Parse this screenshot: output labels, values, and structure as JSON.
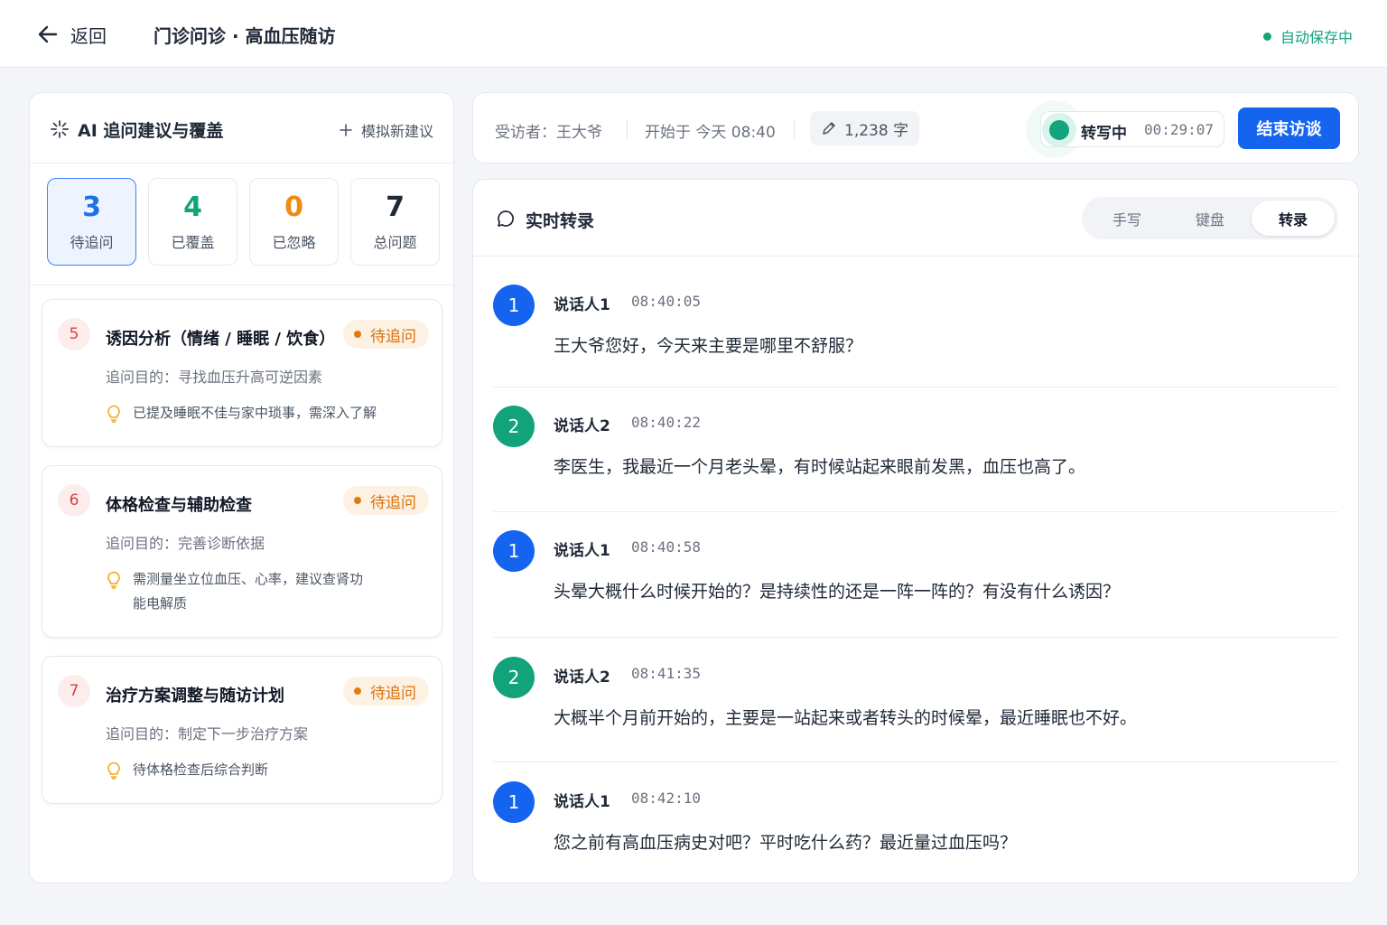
{
  "header": {
    "back_label": "返回",
    "title": "门诊问诊 · 高血压随访",
    "autosave": "自动保存中"
  },
  "left_panel": {
    "title": "AI 追问建议与覆盖",
    "simulate_label": "模拟新建议",
    "stats": [
      {
        "value": "3",
        "label": "待追问",
        "color": "#1f6fe5"
      },
      {
        "value": "4",
        "label": "已覆盖",
        "color": "#13a37a"
      },
      {
        "value": "0",
        "label": "已忽略",
        "color": "#f08a12"
      },
      {
        "value": "7",
        "label": "总问题",
        "color": "#1f2937"
      }
    ],
    "cards": [
      {
        "index": "5",
        "title": "诱因分析（情绪 / 睡眠 / 饮食）",
        "status": "待追问",
        "purpose": "追问目的：寻找血压升高可逆因素",
        "note": "已提及睡眠不佳与家中琐事，需深入了解"
      },
      {
        "index": "6",
        "title": "体格检查与辅助检查",
        "status": "待追问",
        "purpose": "追问目的：完善诊断依据",
        "note": "需测量坐立位血压、心率，建议查肾功能电解质"
      },
      {
        "index": "7",
        "title": "治疗方案调整与随访计划",
        "status": "待追问",
        "purpose": "追问目的：制定下一步治疗方案",
        "note": "待体格检查后综合判断"
      }
    ]
  },
  "session": {
    "interviewee": "受访者：王大爷",
    "started": "开始于 今天 08:40",
    "word_count": "1,238 字",
    "rec_status": "转写中",
    "rec_time": "00:29:07",
    "end_label": "结束访谈"
  },
  "transcript": {
    "title": "实时转录",
    "modes": [
      "手写",
      "键盘",
      "转录"
    ],
    "active_mode": "转录",
    "speaker_colors": {
      "1": "#1464f0",
      "2": "#12a37a"
    },
    "messages": [
      {
        "speaker_no": "1",
        "speaker": "说话人1",
        "time": "08:40:05",
        "text": "王大爷您好，今天来主要是哪里不舒服？"
      },
      {
        "speaker_no": "2",
        "speaker": "说话人2",
        "time": "08:40:22",
        "text": "李医生，我最近一个月老头晕，有时候站起来眼前发黑，血压也高了。"
      },
      {
        "speaker_no": "1",
        "speaker": "说话人1",
        "time": "08:40:58",
        "text": "头晕大概什么时候开始的？是持续性的还是一阵一阵的？有没有什么诱因？"
      },
      {
        "speaker_no": "2",
        "speaker": "说话人2",
        "time": "08:41:35",
        "text": "大概半个月前开始的，主要是一站起来或者转头的时候晕，最近睡眠也不好。"
      },
      {
        "speaker_no": "1",
        "speaker": "说话人1",
        "time": "08:42:10",
        "text": "您之前有高血压病史对吧？平时吃什么药？最近量过血压吗？"
      }
    ]
  }
}
